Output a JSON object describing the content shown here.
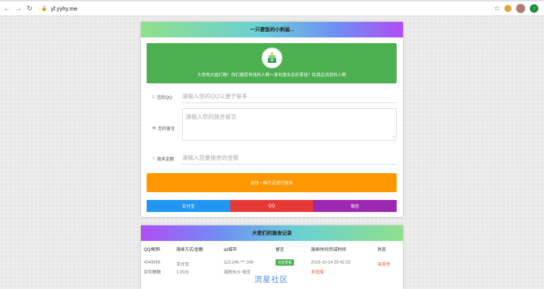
{
  "browser": {
    "url": "yf.yyhy.me",
    "back_icon": "arrow-left-icon",
    "forward_icon": "arrow-right-icon",
    "reload_icon": "reload-icon",
    "lock_icon": "lock-icon",
    "star_icon": "star-icon"
  },
  "main": {
    "title": "一只要饭的小刺画...",
    "banner_text": "大哥哥大姐们啊！你们都是有钱的人啊～谁有那多余的零钱？给我这流浪的人啊",
    "qq_label": "您的QQ",
    "qq_placeholder": "请输入您的QQ以便于联系",
    "message_label": "您的留言",
    "message_placeholder": "请输入您的施舍留言",
    "amount_label": "施舍金额",
    "amount_placeholder": "请输入您要施舍的金额",
    "choose_button": "选择一种方式进行施舍",
    "pay_methods": [
      {
        "label": "支付宝",
        "color": "#2196f3"
      },
      {
        "label": "QQ",
        "color": "#e53935"
      },
      {
        "label": "微信",
        "color": "#9c27b0"
      }
    ]
  },
  "records": {
    "title": "大佬们的施舍记录",
    "headers": [
      "QQ/昵称",
      "施舍方式/金额",
      "ip/城市",
      "留言",
      "施舍时间/完成时间",
      "状态"
    ],
    "rows": [
      {
        "qq": "4049659",
        "nick": "拾你糖糖",
        "method": "支付宝",
        "amount": "1.00元",
        "ip": "113.246.***.249",
        "city": "湖南长沙 电信",
        "message_button": "点击查看",
        "time": "2019-10-14 20:42:23",
        "finish": "未完成",
        "status": "未支付"
      }
    ]
  },
  "watermark": "流星社区"
}
